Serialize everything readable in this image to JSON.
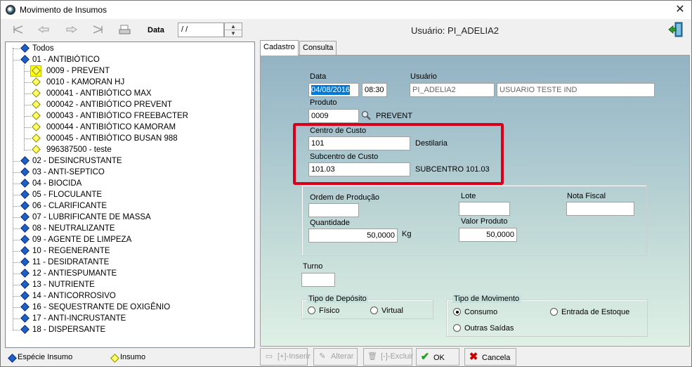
{
  "window": {
    "title": "Movimento de Insumos",
    "close_icon": "close-icon"
  },
  "toolbar": {
    "date_label": "Data",
    "date_value": " / /",
    "user_header": "Usuário: PI_ADELIA2",
    "icons": [
      "first-record-icon",
      "previous-record-icon",
      "next-record-icon",
      "last-record-icon",
      "print-icon"
    ]
  },
  "tree": {
    "root": "Todos",
    "groups": [
      {
        "label": "01 - ANTIBIÓTICO",
        "children": [
          "0009 - PREVENT",
          "0010 - KAMORAN HJ",
          "000041 - ANTIBIÓTICO MAX",
          "000042 - ANTIBIÓTICO PREVENT",
          "000043 - ANTIBIÓTICO FREEBACTER",
          "000044 - ANTIBIÓTICO KAMORAM",
          "000045 - ANTIBIÓTICO BUSAN 988",
          "996387500 - teste"
        ]
      },
      {
        "label": "02 - DESINCRUSTANTE"
      },
      {
        "label": "03 - ANTI-SEPTICO"
      },
      {
        "label": "04 - BIOCIDA"
      },
      {
        "label": "05 - FLOCULANTE"
      },
      {
        "label": "06 - CLARIFICANTE"
      },
      {
        "label": "07 - LUBRIFICANTE DE MASSA"
      },
      {
        "label": "08 - NEUTRALIZANTE"
      },
      {
        "label": "09 - AGENTE DE LIMPEZA"
      },
      {
        "label": "10 - REGENERANTE"
      },
      {
        "label": "11 - DESIDRATANTE"
      },
      {
        "label": "12 - ANTIESPUMANTE"
      },
      {
        "label": "13 - NUTRIENTE"
      },
      {
        "label": "14 - ANTICORROSIVO"
      },
      {
        "label": "16 - SEQUESTRANTE DE OXIGÊNIO"
      },
      {
        "label": "17 - ANTI-INCRUSTANTE"
      },
      {
        "label": "18 - DISPERSANTE"
      }
    ],
    "selected": "0009 - PREVENT"
  },
  "legend": {
    "especie": "Espécie Insumo",
    "insumo": "Insumo"
  },
  "tabs": {
    "cadastro": "Cadastro",
    "consulta": "Consulta"
  },
  "form": {
    "data_label": "Data",
    "data_value": "04/08/2016",
    "hora_value": "08:30",
    "usuario_label": "Usuário",
    "usuario_login": "PI_ADELIA2",
    "usuario_name": "USUARIO TESTE IND",
    "produto_label": "Produto",
    "produto_code": "0009",
    "produto_name": "PREVENT",
    "centro_label": "Centro de Custo",
    "centro_code": "101",
    "centro_name": "Destilaria",
    "subcentro_label": "Subcentro de Custo",
    "subcentro_code": "101.03",
    "subcentro_name": "SUBCENTRO 101.03",
    "ordem_label": "Ordem de Produção",
    "ordem_value": "",
    "lote_label": "Lote",
    "lote_value": "",
    "nota_label": "Nota Fiscal",
    "nota_value": "",
    "quantidade_label": "Quantidade",
    "quantidade_value": "50,0000",
    "quantidade_unit": "Kg",
    "valor_label": "Valor Produto",
    "valor_value": "50,0000",
    "turno_label": "Turno",
    "turno_value": "",
    "deposito_title": "Tipo de Depósito",
    "deposito_fisico": "Físico",
    "deposito_virtual": "Virtual",
    "movimento_title": "Tipo de Movimento",
    "mov_consumo": "Consumo",
    "mov_entrada": "Entrada de Estoque",
    "mov_outras": "Outras Saídas",
    "mov_selected": "Consumo"
  },
  "buttons": {
    "inserir": "[+]-Inserir",
    "alterar": "Alterar",
    "excluir": "[-]-Excluir",
    "ok": "OK",
    "cancela": "Cancela"
  },
  "colors": {
    "highlight_border": "#d9001b",
    "ok_green": "#1e9e1e",
    "cancel_red": "#cc0000"
  }
}
